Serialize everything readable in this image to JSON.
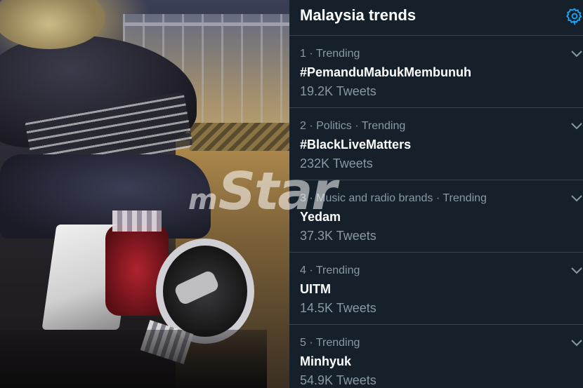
{
  "panel": {
    "title": "Malaysia trends",
    "settings_icon": "gear-icon",
    "accent_color": "#1da1f2",
    "background_color": "#15202b"
  },
  "watermark": {
    "prefix": "m",
    "text": "Star"
  },
  "trends": [
    {
      "rank": "1",
      "meta": "1 · Trending",
      "name": "#PemanduMabukMembunuh",
      "count": "19.2K Tweets"
    },
    {
      "rank": "2",
      "meta": "2 · Politics · Trending",
      "name": "#BlackLiveMatters",
      "count": "232K Tweets"
    },
    {
      "rank": "3",
      "meta": "3 · Music and radio brands · Trending",
      "name": "Yedam",
      "count": "37.3K Tweets"
    },
    {
      "rank": "4",
      "meta": "4 · Trending",
      "name": "UITM",
      "count": "14.5K Tweets"
    },
    {
      "rank": "5",
      "meta": "5 · Trending",
      "name": "Minhyuk",
      "count": "54.9K Tweets"
    }
  ]
}
